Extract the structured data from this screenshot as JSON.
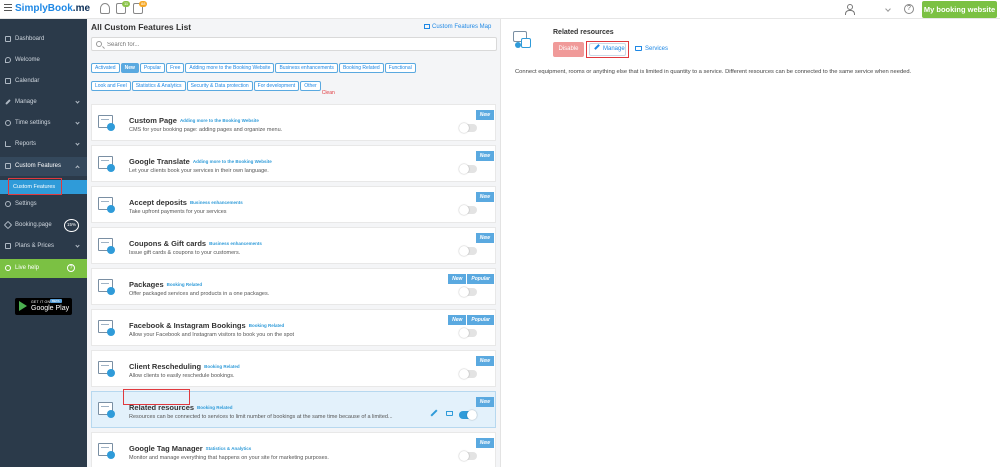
{
  "header": {
    "logo": "SimplyBook",
    "logo_tld": ".me",
    "notif_badges": [
      "11",
      "88"
    ],
    "help_icon": "?",
    "my_booking_label": "My booking website"
  },
  "sidebar": {
    "items": [
      {
        "label": "Dashboard",
        "icon": "dashboard-icon"
      },
      {
        "label": "Welcome",
        "icon": "pin-icon"
      },
      {
        "label": "Calendar",
        "icon": "calendar-icon"
      },
      {
        "label": "Manage",
        "icon": "pencil-icon",
        "chevron": "down"
      },
      {
        "label": "Time settings",
        "icon": "clock-icon",
        "chevron": "down"
      },
      {
        "label": "Reports",
        "icon": "chart-icon",
        "chevron": "down"
      },
      {
        "label": "Custom Features",
        "icon": "features-icon",
        "chevron": "up"
      }
    ],
    "subitem": "Custom Features",
    "items2": [
      {
        "label": "Settings",
        "icon": "gear-icon"
      },
      {
        "label": "Booking.page",
        "icon": "sparkle-icon",
        "percent": "15%"
      },
      {
        "label": "Plans & Prices",
        "icon": "plans-icon",
        "chevron": "down"
      },
      {
        "label": "Live help",
        "icon": "chat-icon",
        "help": "?"
      }
    ],
    "google_play": {
      "small": "GET IT ON",
      "big": "Google Play",
      "beta": "BETA"
    }
  },
  "list": {
    "title": "All Custom Features List",
    "map_link": "Custom Features Map",
    "search_placeholder": "Search for...",
    "tags": [
      "Activated",
      "New",
      "Popular",
      "Free",
      "Adding more to the Booking Website",
      "Business enhancements",
      "Booking Related",
      "Functional",
      "Look and Feel",
      "Statistics & Analytics",
      "Security & Data protection",
      "For development",
      "Other"
    ],
    "clean_label": "Clean",
    "features": [
      {
        "title": "Custom Page",
        "category": "Adding more to the Booking Website",
        "desc": "CMS for your booking page: adding pages and organize menu.",
        "badges": [
          "New"
        ],
        "enabled": false
      },
      {
        "title": "Google Translate",
        "category": "Adding more to the Booking Website",
        "desc": "Let your clients book your services in their own language.",
        "badges": [
          "New"
        ],
        "enabled": false
      },
      {
        "title": "Accept deposits",
        "category": "Business enhancements",
        "desc": "Take upfront payments for your services",
        "badges": [
          "New"
        ],
        "enabled": false
      },
      {
        "title": "Coupons & Gift cards",
        "category": "Business enhancements",
        "desc": "Issue gift cards & coupons to your customers.",
        "badges": [
          "New"
        ],
        "enabled": false
      },
      {
        "title": "Packages",
        "category": "Booking Related",
        "desc": "Offer packaged services and products in a one packages.",
        "badges": [
          "New",
          "Popular"
        ],
        "enabled": false
      },
      {
        "title": "Facebook & Instagram Bookings",
        "category": "Booking Related",
        "desc": "Allow your Facebook and Instagram visitors to book you on the spot",
        "badges": [
          "New",
          "Popular"
        ],
        "enabled": false
      },
      {
        "title": "Client Rescheduling",
        "category": "Booking Related",
        "desc": "Allow clients to easily reschedule bookings.",
        "badges": [
          "New"
        ],
        "enabled": false
      },
      {
        "title": "Related resources",
        "category": "Booking Related",
        "desc": "Resources can be connected to services to limit number of bookings at the same time because of a limited...",
        "badges": [
          "New"
        ],
        "enabled": true,
        "selected": true
      },
      {
        "title": "Google Tag Manager",
        "category": "Statistics & Analytics",
        "desc": "Monitor and manage everything that happens on your site for marketing purposes.",
        "badges": [
          "New"
        ],
        "enabled": false
      }
    ]
  },
  "detail": {
    "title": "Related resources",
    "disable_label": "Disable",
    "manage_label": "Manage",
    "services_label": "Services",
    "description": "Connect equipment, rooms or anything else that is limited in quantity to a service. Different resources can be connected to the same service when needed."
  },
  "colors": {
    "accent": "#2f9bd9",
    "green": "#7bc143",
    "sidebar": "#2b3a4a",
    "highlight": "#e0393e",
    "disable": "#f09a99"
  }
}
